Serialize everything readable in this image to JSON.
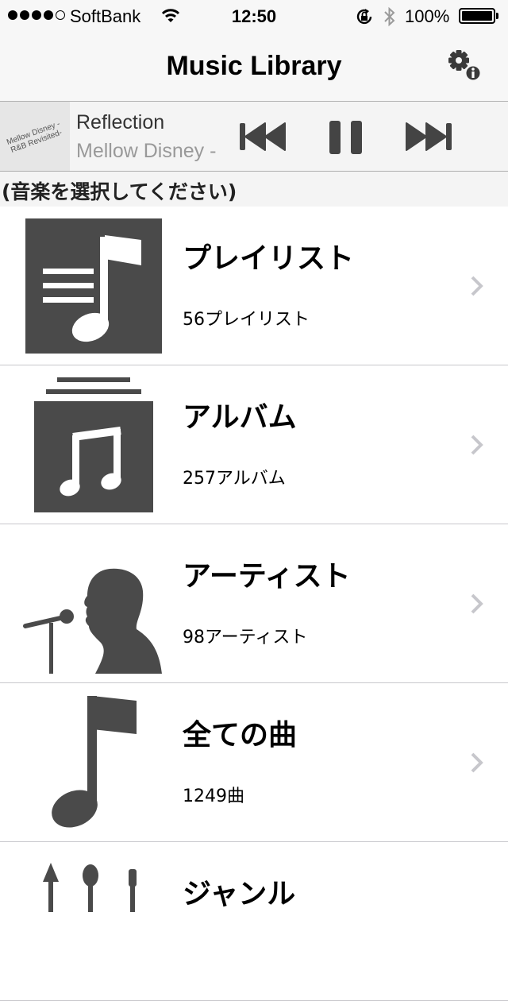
{
  "status_bar": {
    "carrier": "SoftBank",
    "time": "12:50",
    "battery_text": "100%",
    "battery_level": 1.0,
    "signal_bars_filled": 4,
    "signal_bars_total": 5
  },
  "nav": {
    "title": "Music Library",
    "settings_icon": "gear-info-icon"
  },
  "now_playing": {
    "title": "Reflection",
    "artist": "Mellow Disney -",
    "artwork_text_line1": "Mellow Disney -",
    "artwork_text_line2": "R&B Revisited-",
    "is_playing": true
  },
  "section_header": "(音楽を選択してください)",
  "categories": [
    {
      "title": "プレイリスト",
      "subtitle": "56プレイリスト",
      "icon": "playlist-icon"
    },
    {
      "title": "アルバム",
      "subtitle": "257アルバム",
      "icon": "album-icon"
    },
    {
      "title": "アーティスト",
      "subtitle": "98アーティスト",
      "icon": "artist-icon"
    },
    {
      "title": "全ての曲",
      "subtitle": "1249曲",
      "icon": "song-icon"
    },
    {
      "title": "ジャンル",
      "subtitle": "",
      "icon": "genre-icon"
    }
  ],
  "colors": {
    "icon_fill": "#4a4a4a",
    "chevron": "#c7c7cc",
    "bar_background": "#f7f7f7"
  }
}
